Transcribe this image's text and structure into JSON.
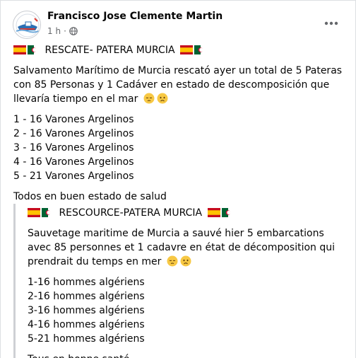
{
  "post": {
    "author": "Francisco Jose Clemente Martin",
    "time": "1 h",
    "separator": "·",
    "privacy_icon": "globe-icon",
    "more_icon": "more-options-icon",
    "avatar_icon": "lifeguard-boat-avatar"
  },
  "spanish": {
    "title": "RESCATE- PATERA MURCIA",
    "paragraph": "Salvamento Marítimo de Murcia rescató ayer un total de 5 Pateras con 85 Personas y 1 Cadáver en estado de descomposición que llevaría tiempo en el mar",
    "list": [
      "1 - 16 Varones Argelinos",
      "2 - 16 Varones Argelinos",
      "3 - 16 Varones Argelinos",
      "4 - 16 Varones Argelinos",
      "5 - 21 Varones Argelinos"
    ],
    "footer": "Todos en buen estado de salud"
  },
  "french": {
    "title": "RESCOURCE-PATERA MURCIA",
    "paragraph": "Sauvetage maritime de Murcia a sauvé hier 5 embarcations avec 85 personnes et 1 cadavre en état de décomposition qui prendrait du temps en mer",
    "list": [
      "1-16 hommes algériens",
      "2-16 hommes algériens",
      "3-16 hommes algériens",
      "4-16 hommes algériens",
      "5-21 hommes algériens"
    ],
    "footer": "Tous en bonne santé"
  },
  "colors": {
    "text": "#050505",
    "secondary": "#65676b",
    "quote_border": "#ced0d4"
  }
}
